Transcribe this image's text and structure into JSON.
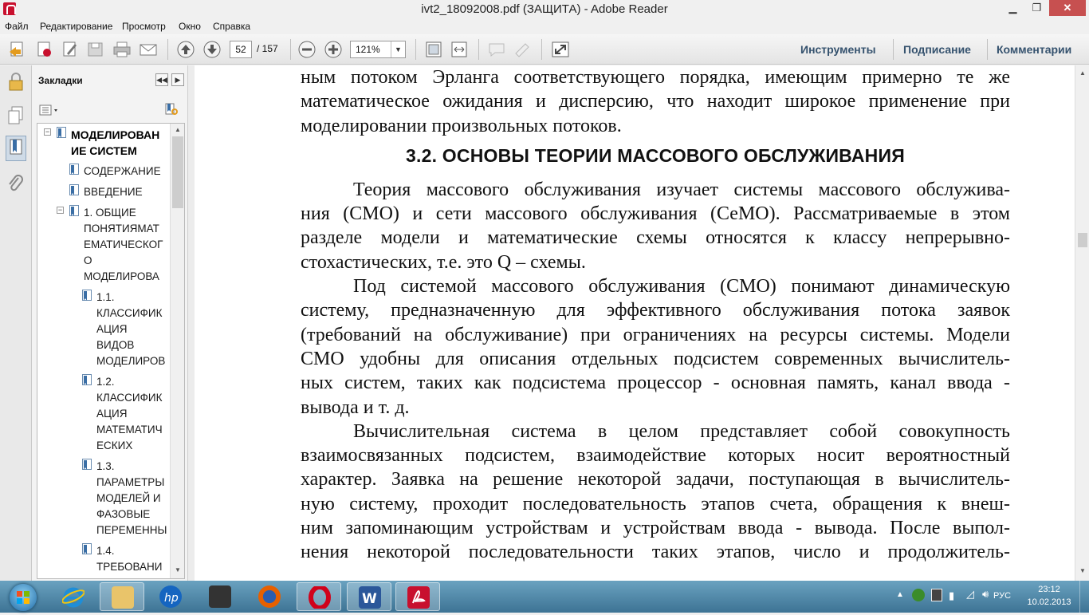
{
  "window": {
    "title": "ivt2_18092008.pdf (ЗАЩИТА) - Adobe Reader",
    "minimize": "▁",
    "maximize": "❐",
    "close": "✕"
  },
  "menu": [
    "Файл",
    "Редактирование",
    "Просмотр",
    "Окно",
    "Справка"
  ],
  "toolbar": {
    "page_current": "52",
    "page_total": "/ 157",
    "zoom": "121%",
    "tools_label": "Инструменты",
    "sign_label": "Подписание",
    "comments_label": "Комментарии"
  },
  "bookmarks": {
    "title": "Закладки",
    "items": [
      {
        "lines": [
          "МОДЕЛИРОВАН",
          "ИЕ СИСТЕМ"
        ],
        "bold": true,
        "level": 0
      },
      {
        "lines": [
          "СОДЕРЖАНИЕ"
        ],
        "level": 1
      },
      {
        "lines": [
          "ВВЕДЕНИЕ"
        ],
        "level": 1
      },
      {
        "lines": [
          "1. ОБЩИЕ",
          "ПОНЯТИЯМАТ",
          "ЕМАТИЧЕСКОГ",
          "О",
          "МОДЕЛИРОВА"
        ],
        "level": 1
      },
      {
        "lines": [
          "1.1.",
          "КЛАССИФИК",
          "АЦИЯ",
          "ВИДОВ",
          "МОДЕЛИРОВ"
        ],
        "level": 2
      },
      {
        "lines": [
          "1.2.",
          "КЛАССИФИК",
          "АЦИЯ",
          "МАТЕМАТИЧ",
          "ЕСКИХ"
        ],
        "level": 2
      },
      {
        "lines": [
          "1.3.",
          "ПАРАМЕТРЫ",
          "МОДЕЛЕЙ И",
          "ФАЗОВЫЕ",
          "ПЕРЕМЕННЫ"
        ],
        "level": 2
      },
      {
        "lines": [
          "1.4.",
          "ТРЕБОВАНИ"
        ],
        "level": 2
      }
    ]
  },
  "document": {
    "intro_lines": [
      "ным потоком Эрланга соответствующего порядка, имеющим примерно те же",
      "математическое ожидания и дисперсию, что находит широкое применение при",
      "моделировании произвольных потоков."
    ],
    "heading": "3.2. ОСНОВЫ ТЕОРИИ МАССОВОГО ОБСЛУЖИВАНИЯ",
    "para1": [
      "Теория массового обслуживания изучает системы массового обслужива-",
      "ния (СМО) и сети массового обслуживания (СеМО). Рассматриваемые в этом",
      "разделе модели и математические схемы относятся к классу непрерывно-",
      "стохастических, т.е. это Q – схемы."
    ],
    "para2": [
      "Под системой массового обслуживания (СМО) понимают динамическую",
      "систему, предназначенную для эффективного обслуживания потока заявок",
      "(требований на обслуживание) при ограничениях на ресурсы системы. Модели",
      "СМО удобны для описания отдельных подсистем современных вычислитель-",
      "ных систем, таких как подсистема процессор - основная память, канал ввода -",
      "вывода и т. д."
    ],
    "para3": [
      "Вычислительная система в целом представляет собой совокупность",
      "взаимосвязанных подсистем, взаимодействие которых носит вероятностный",
      "характер. Заявка на решение некоторой задачи, поступающая в вычислитель-",
      "ную систему, проходит последовательность этапов счета, обращения к внеш-",
      "ним запоминающим устройствам и устройствам ввода - вывода. После выпол-",
      "нения некоторой последовательности таких этапов, число и продолжитель-"
    ]
  },
  "taskbar": {
    "apps": [
      "internet-explorer",
      "file-explorer",
      "hp",
      "media-app",
      "firefox",
      "opera",
      "word",
      "adobe-reader"
    ],
    "lang": "РУС",
    "time": "23:12",
    "date": "10.02.2013"
  },
  "colors": {
    "accent_text": "#35526e",
    "close_button": "#c75050",
    "taskbar": "#4f86a8"
  }
}
